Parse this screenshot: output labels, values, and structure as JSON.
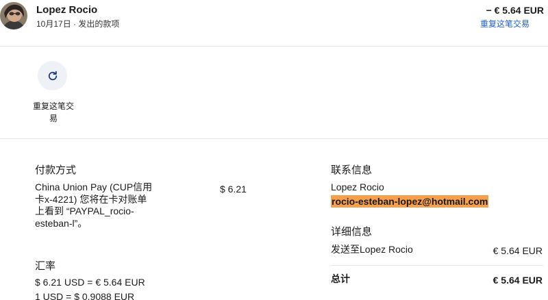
{
  "header": {
    "name": "Lopez Rocio",
    "subline": "10月17日 · 发出的款项",
    "amount": "− € 5.64 EUR",
    "repeat_link": "重复这笔交易"
  },
  "actions": {
    "repeat_label": "重复这笔交易"
  },
  "payment": {
    "title": "付款方式",
    "description": "China Union Pay (CUP信用卡x-4221) 您将在卡对账单上看到 “PAYPAL_rocio-esteban-l”。",
    "amount": "$ 6.21"
  },
  "exchange": {
    "title": "汇率",
    "line1": "$ 6.21 USD = € 5.64 EUR",
    "line2": "1 USD = $ 0.9088 EUR"
  },
  "contact": {
    "title": "联系信息",
    "name": "Lopez Rocio",
    "email": "rocio-esteban-lopez@hotmail.com"
  },
  "details": {
    "title": "详细信息",
    "sent_label": "发送至Lopez Rocio",
    "sent_amount": "€ 5.64 EUR",
    "total_label": "总计",
    "total_amount": "€ 5.64 EUR"
  },
  "colors": {
    "link": "#1d5fd6",
    "highlight": "#f6a04d"
  }
}
